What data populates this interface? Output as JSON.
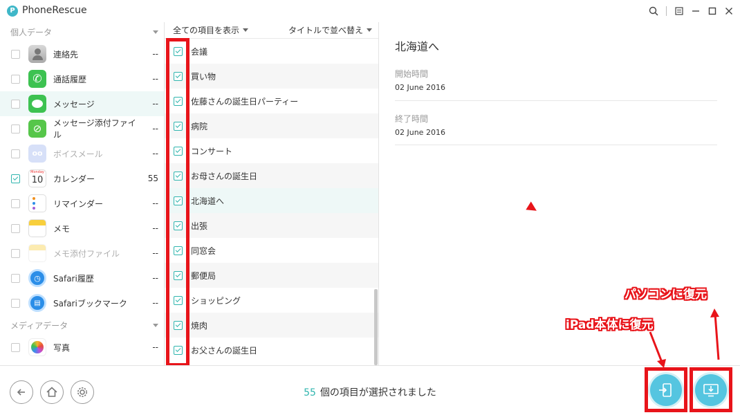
{
  "app": {
    "name": "PhoneRescue",
    "logo": "P"
  },
  "sidebar": {
    "section_personal": "個人データ",
    "section_media": "メディアデータ",
    "items": [
      {
        "label": "連絡先",
        "count": "--",
        "icon": "contacts-icon",
        "checked": false,
        "selected": false,
        "dim": false
      },
      {
        "label": "通話履歴",
        "count": "--",
        "icon": "phone-icon",
        "checked": false,
        "selected": false,
        "dim": false
      },
      {
        "label": "メッセージ",
        "count": "--",
        "icon": "messages-icon",
        "checked": false,
        "selected": true,
        "dim": false
      },
      {
        "label": "メッセージ添付ファイル",
        "count": "--",
        "icon": "attachment-icon",
        "checked": false,
        "selected": false,
        "dim": false
      },
      {
        "label": "ボイスメール",
        "count": "--",
        "icon": "voicemail-icon",
        "checked": false,
        "selected": false,
        "dim": true
      },
      {
        "label": "カレンダー",
        "count": "55",
        "icon": "calendar-icon",
        "checked": true,
        "selected": false,
        "dim": false
      },
      {
        "label": "リマインダー",
        "count": "--",
        "icon": "reminders-icon",
        "checked": false,
        "selected": false,
        "dim": false
      },
      {
        "label": "メモ",
        "count": "--",
        "icon": "notes-icon",
        "checked": false,
        "selected": false,
        "dim": false
      },
      {
        "label": "メモ添付ファイル",
        "count": "--",
        "icon": "notes-attachment-icon",
        "checked": false,
        "selected": false,
        "dim": true
      },
      {
        "label": "Safari履歴",
        "count": "--",
        "icon": "safari-history-icon",
        "checked": false,
        "selected": false,
        "dim": false
      },
      {
        "label": "Safariブックマーク",
        "count": "--",
        "icon": "safari-bookmark-icon",
        "checked": false,
        "selected": false,
        "dim": false
      }
    ],
    "media_items": [
      {
        "label": "写真",
        "count": "--",
        "icon": "photos-icon",
        "checked": false
      }
    ],
    "calendar_icon_month": "Monday",
    "calendar_icon_day": "10"
  },
  "list": {
    "filter_label": "全ての項目を表示",
    "sort_label": "タイトルで並べ替え",
    "rows": [
      "会議",
      "買い物",
      "佐藤さんの誕生日パーティー",
      "病院",
      "コンサート",
      "お母さんの誕生日",
      "北海道へ",
      "出張",
      "同窓会",
      "郵便局",
      "ショッピング",
      "焼肉",
      "お父さんの誕生日"
    ],
    "selected_index": 6
  },
  "detail": {
    "title": "北海道へ",
    "start_label": "開始時間",
    "start_value": "02 June 2016",
    "end_label": "終了時間",
    "end_value": "02 June 2016"
  },
  "status": {
    "count": "55",
    "text": "個の項目が選択されました"
  },
  "annotations": {
    "restore_device": "iPad本体に復元",
    "restore_pc": "パソコンに復元"
  },
  "colors": {
    "accent": "#2fb5ae",
    "annotation_red": "#e8141a",
    "action_blue": "#55c5e0"
  }
}
